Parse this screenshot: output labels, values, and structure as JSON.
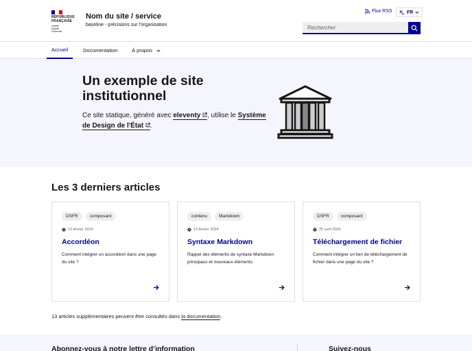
{
  "header": {
    "logo": {
      "line1": "RÉPUBLIQUE",
      "line2": "FRANÇAISE",
      "motto1": "Liberté",
      "motto2": "Égalité",
      "motto3": "Fraternité"
    },
    "site_name": "Nom du site / service",
    "baseline": "baseline - précisions sur l'organisation",
    "rss_label": "Flux RSS",
    "lang_label": "FR",
    "search_placeholder": "Rechercher",
    "colors": {
      "blue": "#000091",
      "red": "#e1000f"
    }
  },
  "nav": {
    "items": [
      {
        "label": "Accueil",
        "active": true
      },
      {
        "label": "Documentation",
        "active": false
      },
      {
        "label": "À propos",
        "active": false
      }
    ]
  },
  "hero": {
    "title": "Un exemple de site institutionnel",
    "text_prefix": "Ce site statique, généré avec ",
    "link1": "eleventy",
    "text_middle": ", utilise le ",
    "link2": "Système de Design de l'État",
    "text_suffix": "."
  },
  "articles": {
    "title": "Les 3 derniers articles",
    "cards": [
      {
        "tags": [
          "DSFR",
          "composant"
        ],
        "date": "13 février 2024",
        "title": "Accordéon",
        "description": "Comment intégrer un accordéon dans une page du site ?"
      },
      {
        "tags": [
          "contenu",
          "Markdown"
        ],
        "date": "13 février 2024",
        "title": "Syntaxe Markdown",
        "description": "Rappel des éléments de syntaxe Markdown principaux et nouveaux éléments."
      },
      {
        "tags": [
          "DSFR",
          "composant"
        ],
        "date": "25 avril 2024",
        "title": "Téléchargement de fichier",
        "description": "Comment intégrer un lien de téléchargement de fichier dans une page du site ?"
      }
    ],
    "more_prefix": "13 articles supplémentaires peuvent être consultés dans ",
    "more_link": "la documentation",
    "more_suffix": "."
  },
  "footer": {
    "newsletter_title": "Abonnez-vous à notre lettre d’information",
    "follow_title": "Suivez-nous"
  }
}
